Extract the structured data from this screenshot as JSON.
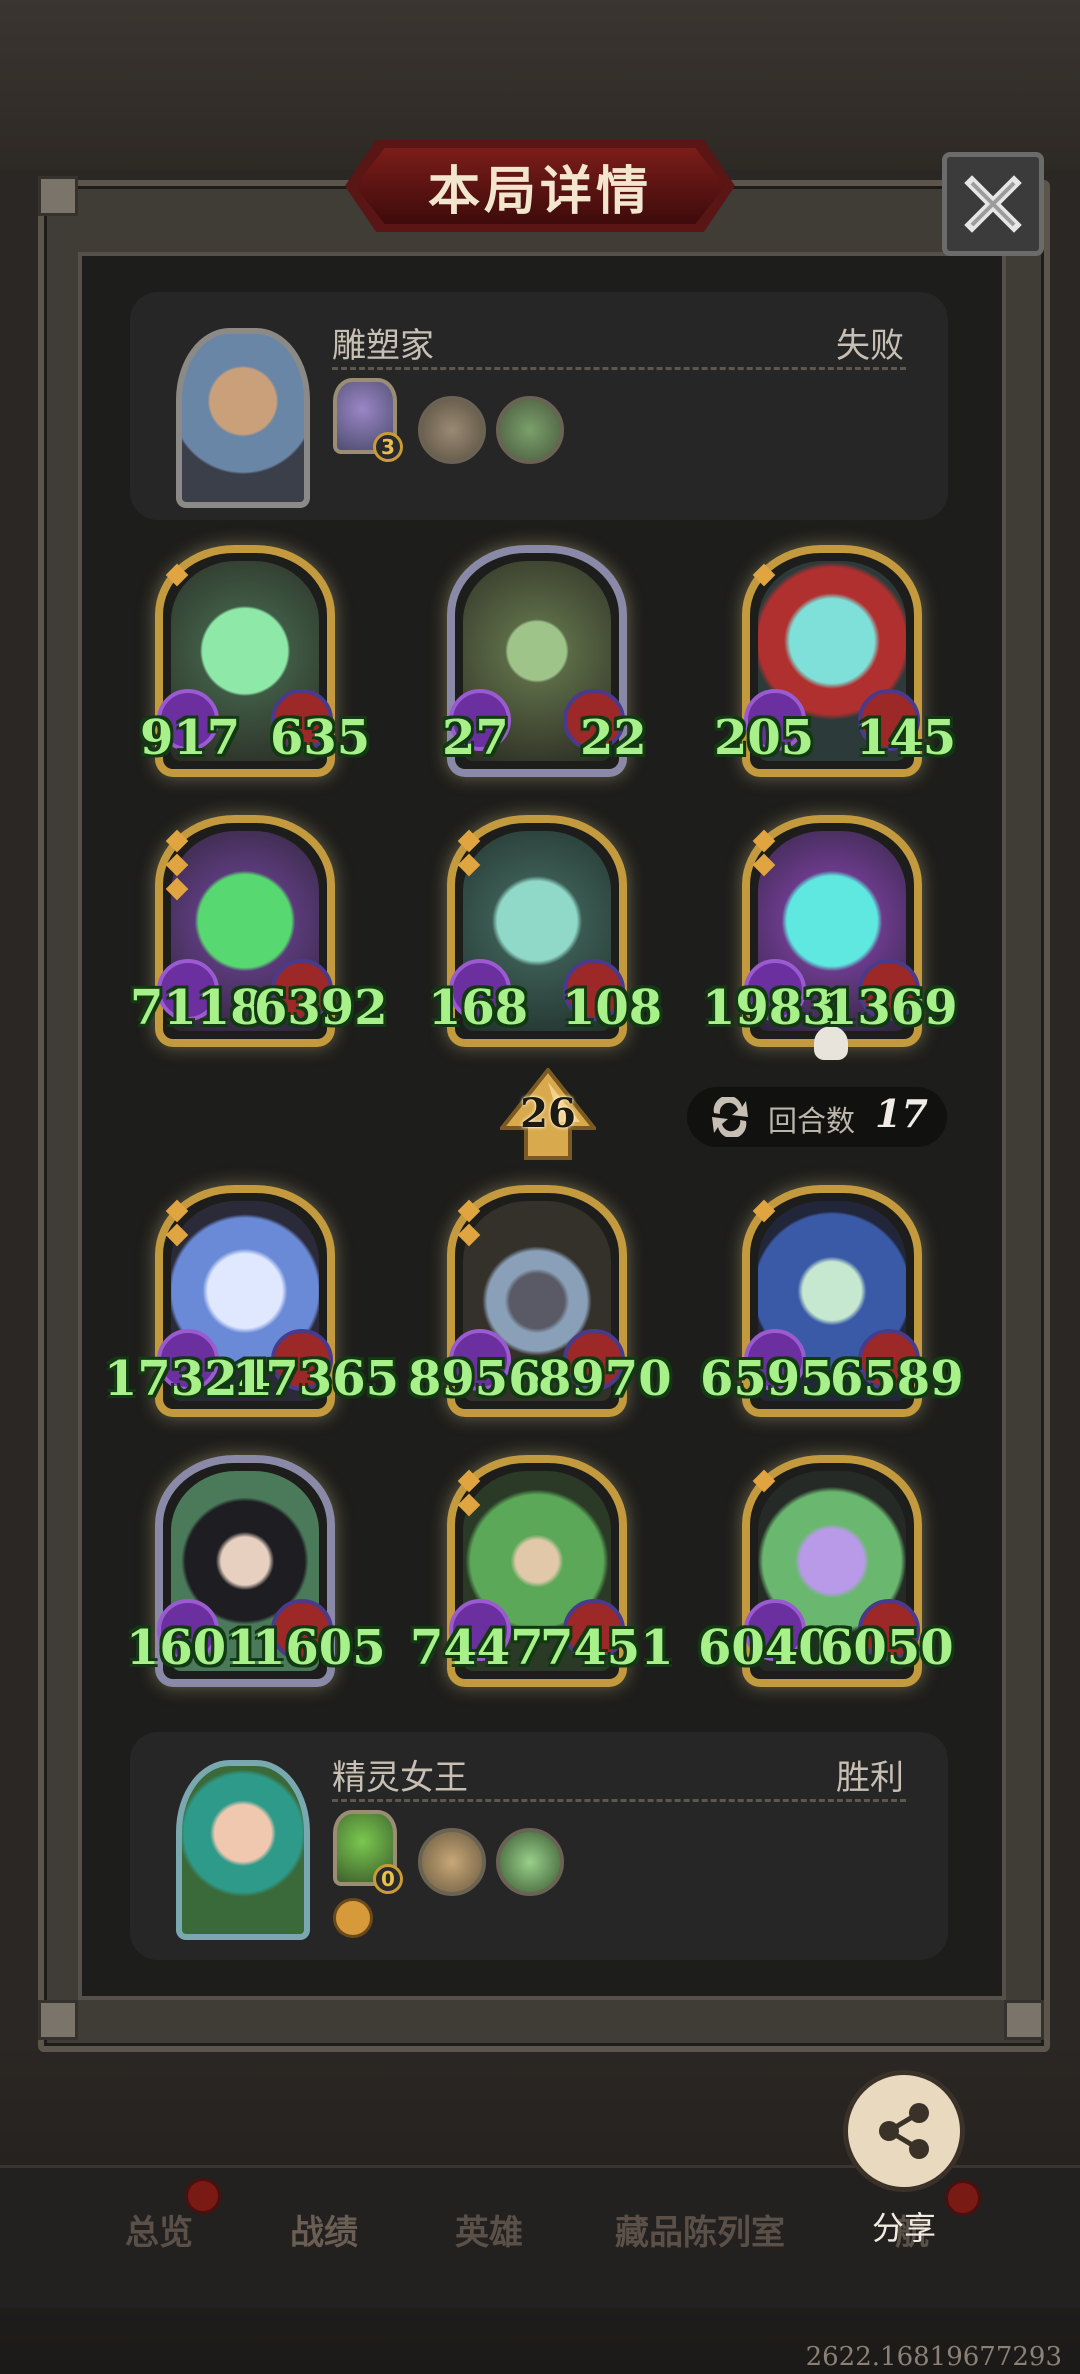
{
  "dialog": {
    "title": "本局详情"
  },
  "opponent": {
    "name": "雕塑家",
    "result": "失败",
    "hero_level": "3"
  },
  "player": {
    "name": "精灵女王",
    "result": "胜利",
    "hero_level": "0"
  },
  "opponent_units": [
    {
      "attack": "917",
      "health": "635"
    },
    {
      "attack": "27",
      "health": "22"
    },
    {
      "attack": "205",
      "health": "145"
    },
    {
      "attack": "7118",
      "health": "6392"
    },
    {
      "attack": "168",
      "health": "108"
    },
    {
      "attack": "1983",
      "health": "1369"
    }
  ],
  "player_units": [
    {
      "attack": "17324",
      "health": "17365"
    },
    {
      "attack": "8956",
      "health": "8970"
    },
    {
      "attack": "6595",
      "health": "6589"
    },
    {
      "attack": "1601",
      "health": "1605"
    },
    {
      "attack": "7447",
      "health": "7451"
    },
    {
      "attack": "6040",
      "health": "6050"
    }
  ],
  "tier": "26",
  "rounds": {
    "label": "回合数",
    "value": "17"
  },
  "share": {
    "label": "分享"
  },
  "nav": [
    "总览",
    "战绩",
    "英雄",
    "藏品陈列室",
    "航"
  ],
  "build_id": "2622.16819677293",
  "colors": {
    "stat_green": "#a8f08a",
    "gold_frame": "#c49a3e",
    "banner_red": "#7b1d1a"
  }
}
